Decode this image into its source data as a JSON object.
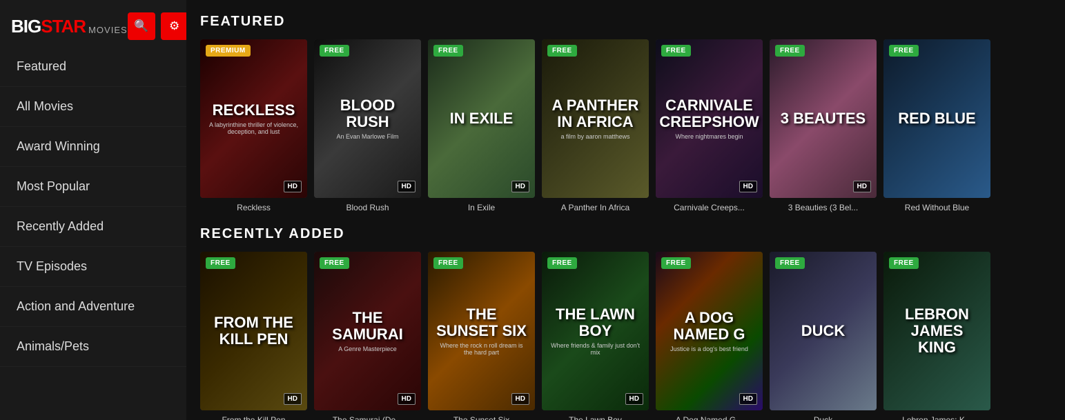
{
  "logo": {
    "big": "BIG",
    "star": "STAR",
    "movies": "MOVIES"
  },
  "nav": {
    "items": [
      {
        "id": "featured",
        "label": "Featured"
      },
      {
        "id": "all-movies",
        "label": "All Movies"
      },
      {
        "id": "award-winning",
        "label": "Award Winning"
      },
      {
        "id": "most-popular",
        "label": "Most Popular"
      },
      {
        "id": "recently-added",
        "label": "Recently Added"
      },
      {
        "id": "tv-episodes",
        "label": "TV Episodes"
      },
      {
        "id": "action-adventure",
        "label": "Action and Adventure"
      },
      {
        "id": "animals-pets",
        "label": "Animals/Pets"
      }
    ]
  },
  "sections": [
    {
      "id": "featured",
      "title": "FEATURED",
      "movies": [
        {
          "id": "reckless",
          "title": "Reckless",
          "badge": "PREMIUM",
          "badgeType": "premium",
          "hd": true,
          "posterClass": "poster-reckless",
          "bigText": "RECKLESS",
          "smallText": "A labyrinthine thriller of violence, deception, and lust"
        },
        {
          "id": "blood-rush",
          "title": "Blood Rush",
          "badge": "FREE",
          "badgeType": "free",
          "hd": true,
          "posterClass": "poster-bloodrush",
          "bigText": "BLOOD RUSH",
          "smallText": "An Evan Marlowe Film"
        },
        {
          "id": "in-exile",
          "title": "In Exile",
          "badge": "FREE",
          "badgeType": "free",
          "hd": true,
          "posterClass": "poster-inexile",
          "bigText": "IN EXILE",
          "smallText": ""
        },
        {
          "id": "panther-africa",
          "title": "A Panther In Africa",
          "badge": "FREE",
          "badgeType": "free",
          "hd": false,
          "posterClass": "poster-panther",
          "bigText": "A PANTHER IN AFRICA",
          "smallText": "a film by aaron matthews"
        },
        {
          "id": "carnivale",
          "title": "Carnivale Creeps...",
          "badge": "FREE",
          "badgeType": "free",
          "hd": true,
          "posterClass": "poster-carnivale",
          "bigText": "CARNIVALE CREEPSHOW",
          "smallText": "Where nightmares begin"
        },
        {
          "id": "3beauties",
          "title": "3 Beauties (3 Bel...",
          "badge": "FREE",
          "badgeType": "free",
          "hd": true,
          "posterClass": "poster-3beauties",
          "bigText": "3 BEAUTES",
          "smallText": ""
        },
        {
          "id": "red-blue",
          "title": "Red Without Blue",
          "badge": "FREE",
          "badgeType": "free",
          "hd": false,
          "posterClass": "poster-redblue",
          "bigText": "RED BLUE",
          "smallText": ""
        }
      ]
    },
    {
      "id": "recently-added",
      "title": "RECENTLY ADDED",
      "movies": [
        {
          "id": "kill-pen",
          "title": "From the Kill Pen",
          "badge": "FREE",
          "badgeType": "free",
          "hd": true,
          "posterClass": "poster-killpen",
          "bigText": "FROM THE KILL PEN",
          "smallText": ""
        },
        {
          "id": "samurai",
          "title": "The Samurai (De...",
          "badge": "FREE",
          "badgeType": "free",
          "hd": true,
          "posterClass": "poster-samurai",
          "bigText": "THE SAMURAI",
          "smallText": "A Genre Masterpiece"
        },
        {
          "id": "sunset-six",
          "title": "The Sunset Six",
          "badge": "FREE",
          "badgeType": "free",
          "hd": true,
          "posterClass": "poster-sunset",
          "bigText": "THE SUNSET SIX",
          "smallText": "Where the rock n roll dream is the hard part"
        },
        {
          "id": "lawn-boy",
          "title": "The Lawn Boy",
          "badge": "FREE",
          "badgeType": "free",
          "hd": true,
          "posterClass": "poster-lawnboy",
          "bigText": "THE LAWN BOY",
          "smallText": "Where friends & family just don't mix"
        },
        {
          "id": "dog-named",
          "title": "A Dog Named G...",
          "badge": "FREE",
          "badgeType": "free",
          "hd": true,
          "posterClass": "poster-dog",
          "bigText": "A DOG NAMED G",
          "smallText": "Justice is a dog's best friend"
        },
        {
          "id": "duck",
          "title": "Duck",
          "badge": "FREE",
          "badgeType": "free",
          "hd": false,
          "posterClass": "poster-duck",
          "bigText": "DUCK",
          "smallText": ""
        },
        {
          "id": "lebron",
          "title": "Lebron James: K...",
          "badge": "FREE",
          "badgeType": "free",
          "hd": false,
          "posterClass": "poster-lebron",
          "bigText": "LEBRON JAMES KING",
          "smallText": ""
        }
      ]
    }
  ],
  "icons": {
    "search": "🔍",
    "gear": "⚙"
  }
}
